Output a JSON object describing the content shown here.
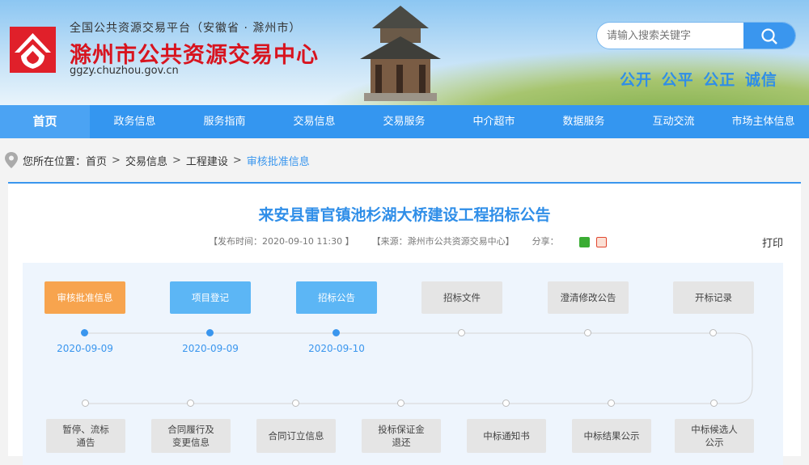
{
  "header": {
    "platform": "全国公共资源交易平台（安徽省 · 滁州市）",
    "site_name": "滁州市公共资源交易中心",
    "url": "ggzy.chuzhou.gov.cn",
    "search_placeholder": "请输入搜索关键字",
    "slogan": "公开 公平 公正 诚信"
  },
  "nav": [
    "首页",
    "政务信息",
    "服务指南",
    "交易信息",
    "交易服务",
    "中介超市",
    "数据服务",
    "互动交流",
    "市场主体信息"
  ],
  "breadcrumb": {
    "prefix": "您所在位置：",
    "items": [
      "首页",
      "交易信息",
      "工程建设"
    ],
    "current": "审核批准信息",
    "sep": ">"
  },
  "article": {
    "title": "来安县雷官镇池杉湖大桥建设工程招标公告",
    "publish": "【发布时间：2020-09-10 11:30 】",
    "source": "【来源：滁州市公共资源交易中心】",
    "share": "分享：",
    "print": "打印"
  },
  "process": {
    "top": [
      {
        "label": "审核批准信息",
        "state": "current",
        "date": "2020-09-09"
      },
      {
        "label": "项目登记",
        "state": "done",
        "date": "2020-09-09"
      },
      {
        "label": "招标公告",
        "state": "done",
        "date": "2020-09-10"
      },
      {
        "label": "招标文件",
        "state": "pending",
        "date": null
      },
      {
        "label": "澄清修改公告",
        "state": "pending",
        "date": null
      },
      {
        "label": "开标记录",
        "state": "pending",
        "date": null
      }
    ],
    "bottom": [
      "暂停、流标\n通告",
      "合同履行及\n变更信息",
      "合同订立信息",
      "投标保证金\n退还",
      "中标通知书",
      "中标结果公示",
      "中标候选人\n公示"
    ]
  },
  "colors": {
    "accent": "#3496f0",
    "orange": "#f7a44e",
    "active_blue": "#5cb6f5",
    "red": "#d8141f"
  }
}
